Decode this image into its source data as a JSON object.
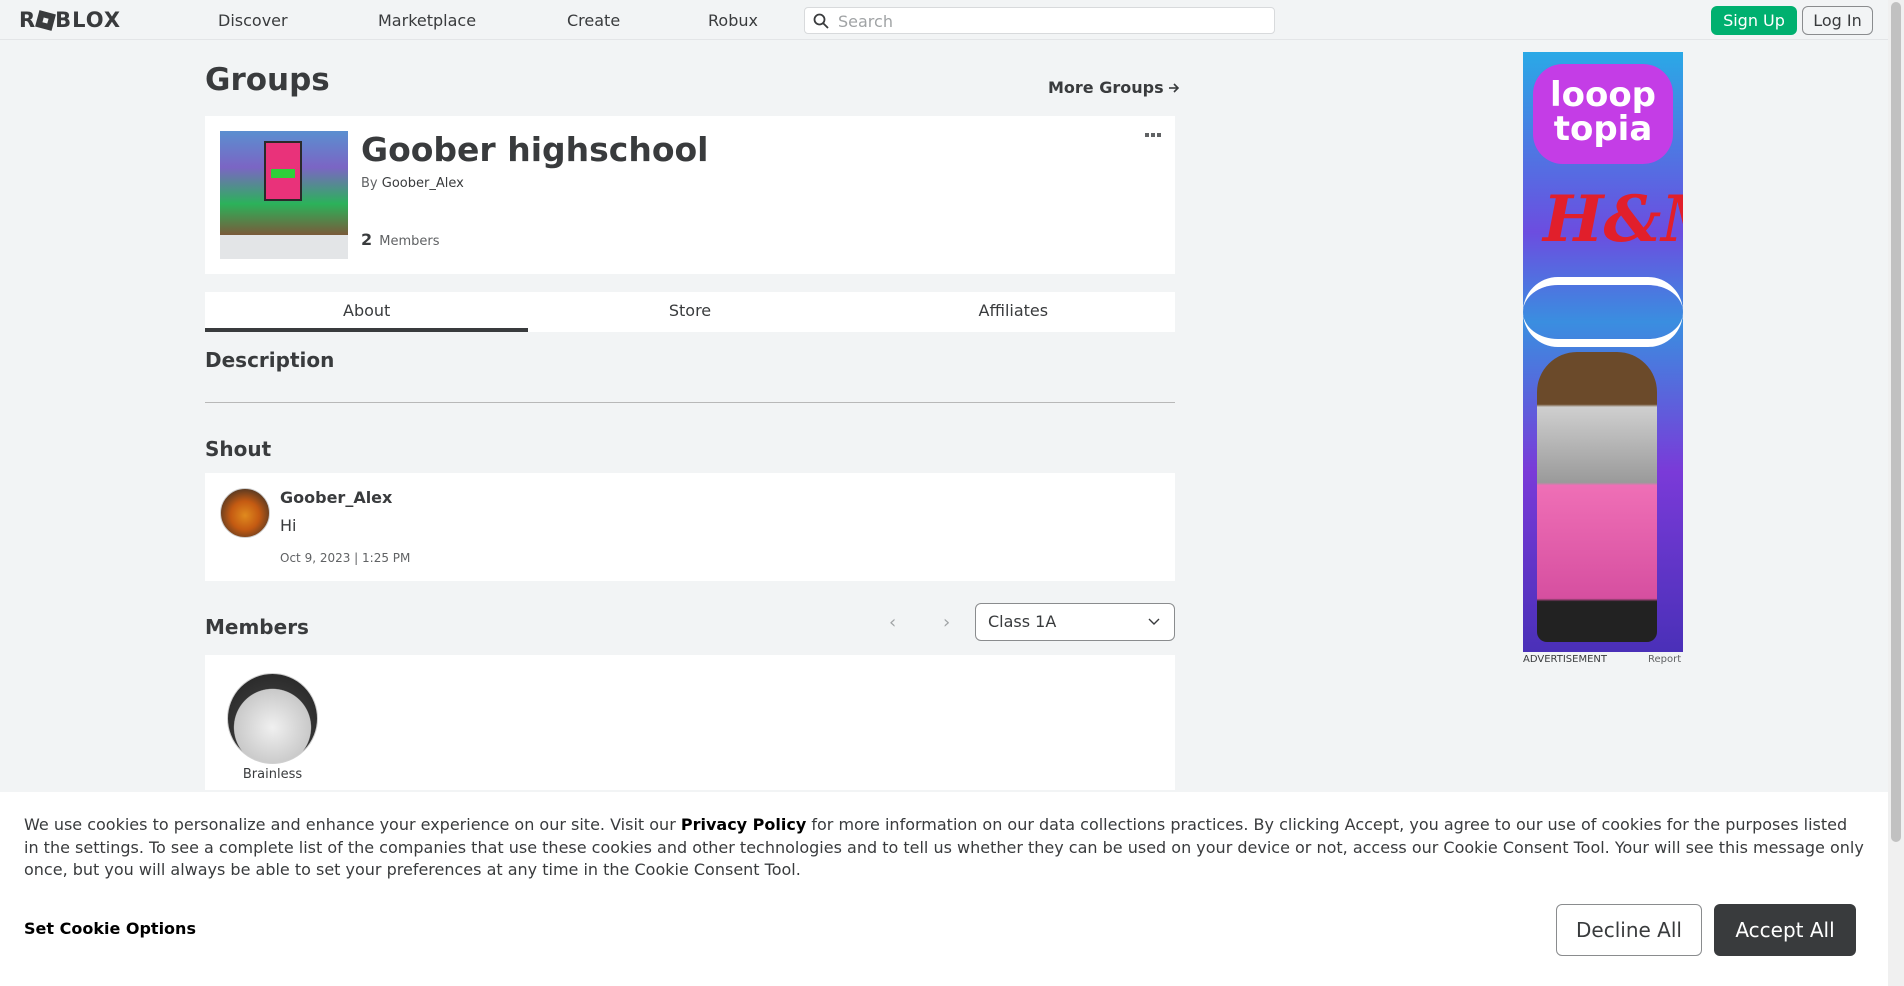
{
  "nav": {
    "logo_text": "ROBLOX",
    "links": [
      "Discover",
      "Marketplace",
      "Create",
      "Robux"
    ],
    "search_placeholder": "Search",
    "signup_label": "Sign Up",
    "login_label": "Log In"
  },
  "page": {
    "title": "Groups",
    "more_groups_label": "More Groups"
  },
  "group": {
    "name": "Goober highschool",
    "by_label": "By",
    "owner": "Goober_Alex",
    "member_count": "2",
    "members_label": "Members"
  },
  "tabs": [
    "About",
    "Store",
    "Affiliates"
  ],
  "sections": {
    "description": "Description",
    "shout": "Shout",
    "members": "Members"
  },
  "shout": {
    "user": "Goober_Alex",
    "message": "Hi",
    "time": "Oct 9, 2023 | 1:25 PM"
  },
  "members": {
    "selected_role": "Class 1A",
    "list": [
      {
        "name": "Brainless"
      }
    ]
  },
  "ad": {
    "brand_line": "looop topia",
    "hm": "H&M",
    "label": "ADVERTISEMENT",
    "report": "Report"
  },
  "cookie": {
    "text_before": "We use cookies to personalize and enhance your experience on our site. Visit our ",
    "link": "Privacy Policy",
    "text_after": " for more information on our data collections practices. By clicking Accept, you agree to our use of cookies for the purposes listed in the settings. To see a complete list of the companies that use these cookies and other technologies and to tell us whether they can be used on your device or not, access our Cookie Consent Tool. Your will see this message only once, but you will always be able to set your preferences at any time in the Cookie Consent Tool.",
    "options_label": "Set Cookie Options",
    "decline_label": "Decline All",
    "accept_label": "Accept All"
  },
  "colors": {
    "accent_green": "#00b06f",
    "text_dark": "#393b3d",
    "background": "#f2f4f5"
  }
}
